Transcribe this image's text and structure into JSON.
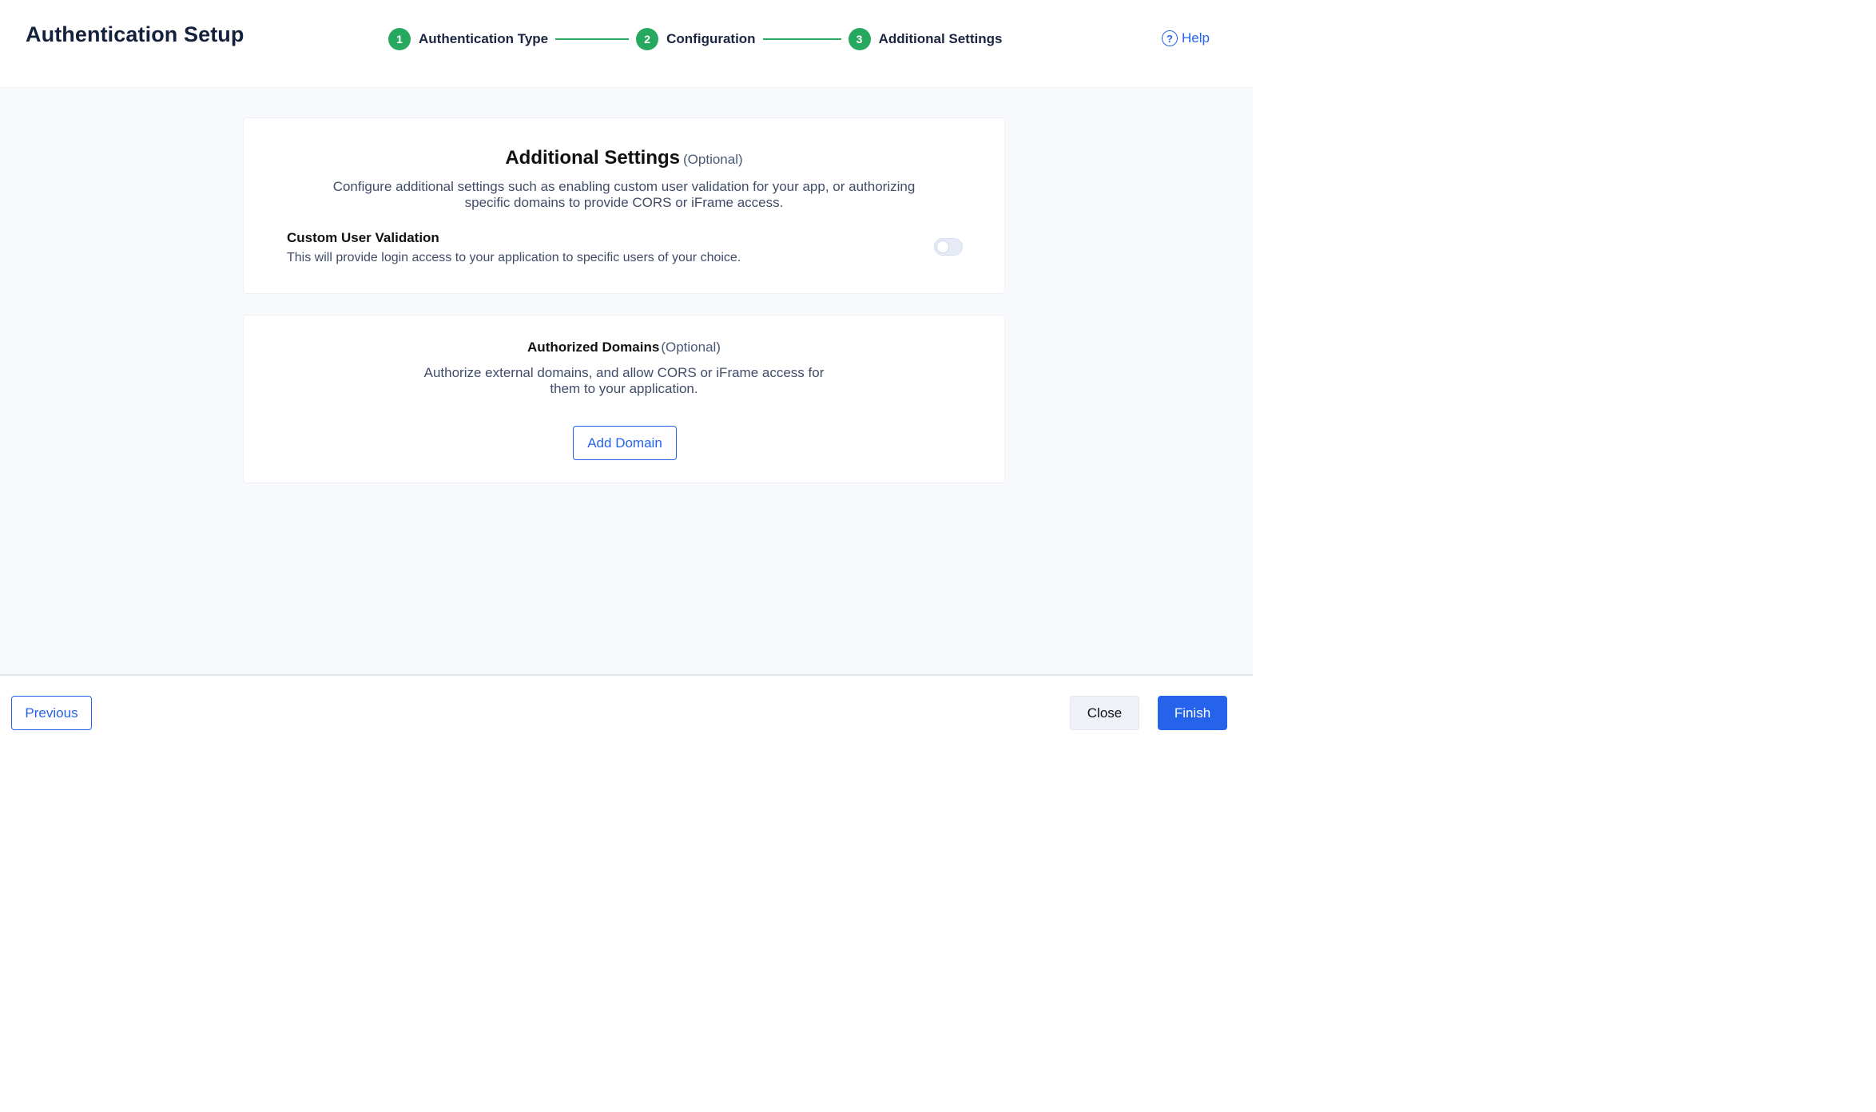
{
  "header": {
    "title": "Authentication Setup",
    "help_label": "Help",
    "help_icon": "question-circle-icon"
  },
  "stepper": {
    "steps": [
      {
        "number": "1",
        "label": "Authentication Type"
      },
      {
        "number": "2",
        "label": "Configuration"
      },
      {
        "number": "3",
        "label": "Additional Settings"
      }
    ],
    "color": "#27a85f"
  },
  "additional_settings": {
    "title": "Additional Settings",
    "optional": "(Optional)",
    "description": "Configure additional settings such as enabling custom user validation for your app, or authorizing specific domains to provide CORS or iFrame access.",
    "custom_user_validation": {
      "title": "Custom User Validation",
      "description": "This will provide login access to your application to specific users of your choice.",
      "enabled": false
    }
  },
  "authorized_domains": {
    "title": "Authorized Domains",
    "optional": "(Optional)",
    "description": "Authorize external domains, and allow CORS or iFrame access for them to your application.",
    "add_label": "Add Domain"
  },
  "footer": {
    "previous_label": "Previous",
    "close_label": "Close",
    "finish_label": "Finish"
  },
  "colors": {
    "accent": "#2563eb",
    "success": "#27a85f"
  }
}
